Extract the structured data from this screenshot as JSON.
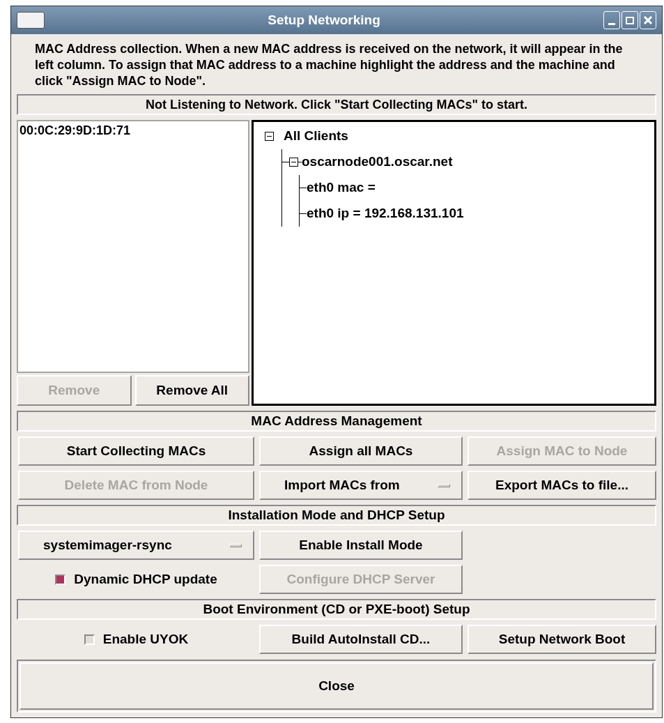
{
  "window": {
    "title": "Setup Networking"
  },
  "description": "MAC Address collection.  When a new MAC address is received on the network, it will appear in the left column.  To assign that MAC address to a machine highlight the address and the machine and click \"Assign MAC to Node\".",
  "status": "Not Listening to Network. Click \"Start Collecting MACs\" to start.",
  "mac_list": {
    "items": [
      {
        "text": "00:0C:29:9D:1D:71",
        "selected": false
      }
    ],
    "buttons": [
      {
        "label": "Remove",
        "disabled": true
      },
      {
        "label": "Remove All",
        "disabled": false
      }
    ]
  },
  "tree": [
    {
      "label": "All Clients",
      "expanded": true,
      "children": [
        {
          "label": "oscarnode001.oscar.net",
          "expanded": true,
          "children": [
            {
              "label": "eth0 mac ="
            },
            {
              "label": "eth0 ip = 192.168.131.101"
            }
          ]
        }
      ]
    }
  ],
  "sections": [
    {
      "title": "MAC Address Management",
      "rows": [
        [
          {
            "kind": "button",
            "label": "Start Collecting MACs",
            "disabled": false
          },
          {
            "kind": "button",
            "label": "Assign all MACs",
            "disabled": false
          },
          {
            "kind": "button",
            "label": "Assign MAC to Node",
            "disabled": true
          }
        ],
        [
          {
            "kind": "button",
            "label": "Delete MAC from Node",
            "disabled": true
          },
          {
            "kind": "dropdown",
            "label": "Import MACs from",
            "disabled": false
          },
          {
            "kind": "button",
            "label": "Export MACs to file...",
            "disabled": false
          }
        ]
      ]
    },
    {
      "title": "Installation Mode and DHCP Setup",
      "rows": [
        [
          {
            "kind": "dropdown",
            "label": "systemimager-rsync",
            "disabled": false
          },
          {
            "kind": "button",
            "label": "Enable Install Mode",
            "disabled": false
          }
        ],
        [
          {
            "kind": "checkbox",
            "label": "Dynamic DHCP update",
            "checked": true
          },
          {
            "kind": "button",
            "label": "Configure DHCP Server",
            "disabled": true
          }
        ]
      ]
    },
    {
      "title": "Boot Environment (CD or PXE-boot) Setup",
      "rows": [
        [
          {
            "kind": "checkbox",
            "label": "Enable UYOK",
            "checked": false
          },
          {
            "kind": "button",
            "label": "Build AutoInstall CD...",
            "disabled": false
          },
          {
            "kind": "button",
            "label": "Setup Network Boot",
            "disabled": false
          }
        ]
      ]
    }
  ],
  "close_button": "Close"
}
